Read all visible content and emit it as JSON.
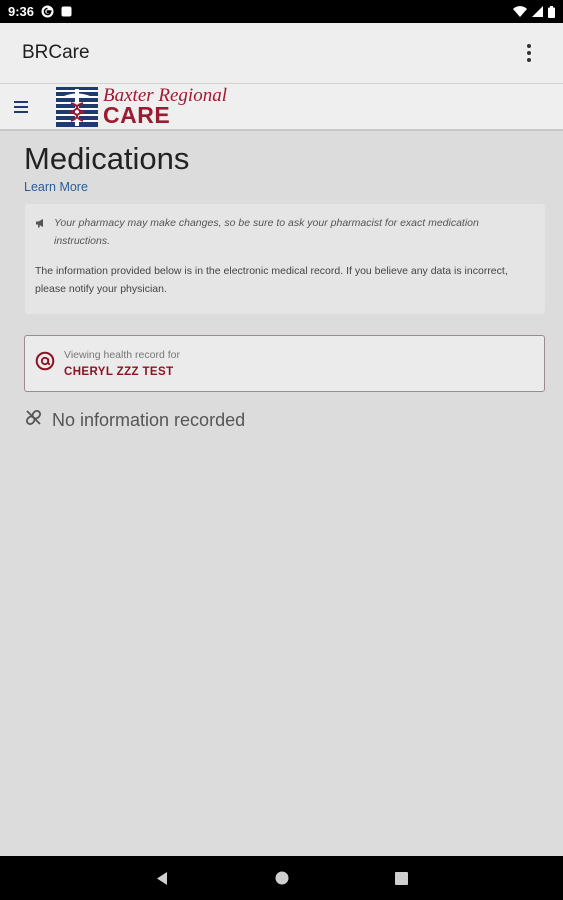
{
  "status_bar": {
    "time": "9:36"
  },
  "app_bar": {
    "title": "BRCare"
  },
  "brand": {
    "line1": "Baxter Regional",
    "line2": "CARE"
  },
  "page": {
    "title": "Medications",
    "learn_more": "Learn More",
    "notice_italic": "Your pharmacy may make changes, so be sure to ask your pharmacist for exact medication instructions.",
    "notice_plain": "The information provided below is in the electronic medical record. If you believe any data is incorrect, please notify your physician."
  },
  "viewing_card": {
    "label": "Viewing health record for",
    "name": "CHERYL ZZZ TEST"
  },
  "empty_state": {
    "text": "No information recorded"
  },
  "colors": {
    "accent": "#9b1b30",
    "link": "#2a5d95",
    "navy": "#1e3a6e"
  }
}
